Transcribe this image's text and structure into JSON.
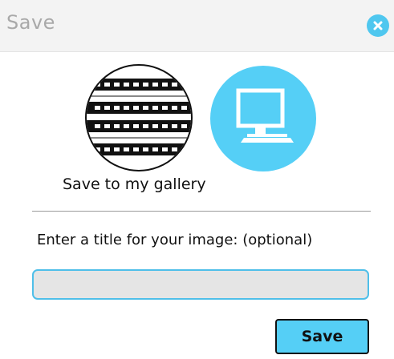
{
  "dialog": {
    "title": "Save",
    "close_icon": "close-icon"
  },
  "options": {
    "gallery": {
      "icon": "film-strip-icon"
    },
    "desktop": {
      "icon": "computer-monitor-icon"
    },
    "selected_label": "Save to my gallery"
  },
  "form": {
    "prompt": "Enter a title for your image: (optional)",
    "title_value": "",
    "title_placeholder": ""
  },
  "actions": {
    "save_label": "Save"
  },
  "colors": {
    "accent": "#55cff6",
    "header_bg": "#f3f3f3",
    "title_text": "#a9a9a9"
  }
}
